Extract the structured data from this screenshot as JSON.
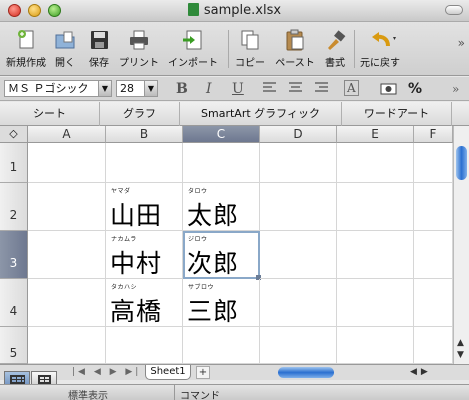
{
  "window": {
    "title": "sample.xlsx"
  },
  "toolbar": {
    "buttons": [
      {
        "label": "新規作成",
        "icon": "new-document-icon"
      },
      {
        "label": "開く",
        "icon": "open-folder-icon"
      },
      {
        "label": "保存",
        "icon": "save-disk-icon"
      },
      {
        "label": "プリント",
        "icon": "printer-icon"
      },
      {
        "label": "インポート",
        "icon": "import-icon"
      },
      {
        "label": "コピー",
        "icon": "copy-icon"
      },
      {
        "label": "ペースト",
        "icon": "paste-icon"
      },
      {
        "label": "書式",
        "icon": "format-brush-icon"
      },
      {
        "label": "元に戻す",
        "icon": "undo-icon"
      }
    ]
  },
  "format": {
    "font": "ＭＳ Ｐゴシック",
    "size": "28",
    "bold": "B",
    "italic": "I",
    "underline": "U",
    "percent": "%"
  },
  "ribbon_tabs": [
    "シート",
    "グラフ",
    "SmartArt グラフィック",
    "ワードアート"
  ],
  "columns": [
    "A",
    "B",
    "C",
    "D",
    "E",
    "F"
  ],
  "rows": [
    "1",
    "2",
    "3",
    "4",
    "5"
  ],
  "selected": {
    "column": "C",
    "row": "3"
  },
  "cells": {
    "B2": {
      "furigana": "ヤマダ",
      "text": "山田"
    },
    "C2": {
      "furigana": "タロウ",
      "text": "太郎"
    },
    "B3": {
      "furigana": "ナカムラ",
      "text": "中村"
    },
    "C3": {
      "furigana": "ジロウ",
      "text": "次郎"
    },
    "B4": {
      "furigana": "タカハシ",
      "text": "高橋"
    },
    "C4": {
      "furigana": "サブロウ",
      "text": "三郎"
    }
  },
  "sheets": [
    "Sheet1"
  ],
  "status": {
    "view": "標準表示",
    "mode": "コマンド"
  },
  "colors": {
    "header_selected": "#6e7890",
    "scroll_thumb": "#2a6fd0",
    "active_cell_border": "#8aa8c8"
  }
}
